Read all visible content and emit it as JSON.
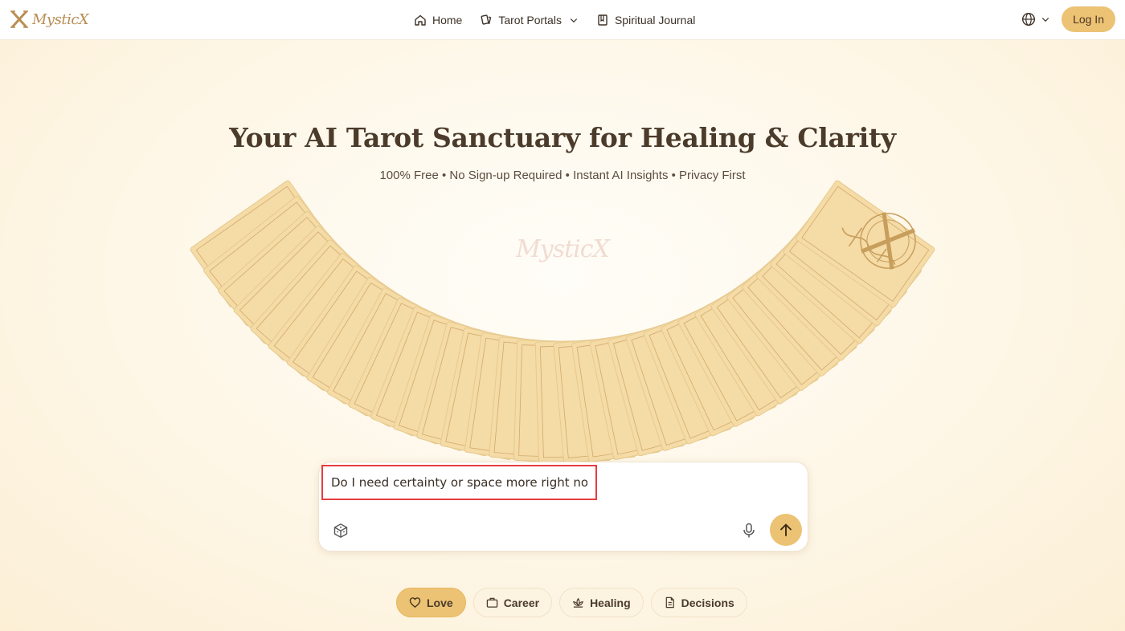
{
  "brand": {
    "name": "MysticX",
    "watermark": "MysticX"
  },
  "nav": {
    "items": [
      {
        "label": "Home",
        "icon": "home-icon"
      },
      {
        "label": "Tarot Portals",
        "icon": "cards-icon",
        "has_dropdown": true
      },
      {
        "label": "Spiritual Journal",
        "icon": "book-icon"
      }
    ],
    "language_icon": "globe-icon",
    "login_label": "Log In"
  },
  "hero": {
    "title": "Your AI Tarot Sanctuary for Healing & Clarity",
    "subtitle": "100% Free • No Sign-up Required • Instant AI Insights • Privacy First"
  },
  "ask": {
    "value": "Do I need certainty or space more right now?",
    "icons": [
      "dice-icon",
      "microphone-icon",
      "arrow-up-icon"
    ]
  },
  "topics": [
    {
      "label": "Love",
      "icon": "heart-icon",
      "active": true
    },
    {
      "label": "Career",
      "icon": "briefcase-icon",
      "active": false
    },
    {
      "label": "Healing",
      "icon": "lotus-icon",
      "active": false
    },
    {
      "label": "Decisions",
      "icon": "document-icon",
      "active": false
    }
  ],
  "colors": {
    "accent": "#ecc274",
    "card": "#f5dba6",
    "card_line": "#c89e5c",
    "highlight_border": "#e53e3e",
    "text": "#4b3b2b"
  }
}
